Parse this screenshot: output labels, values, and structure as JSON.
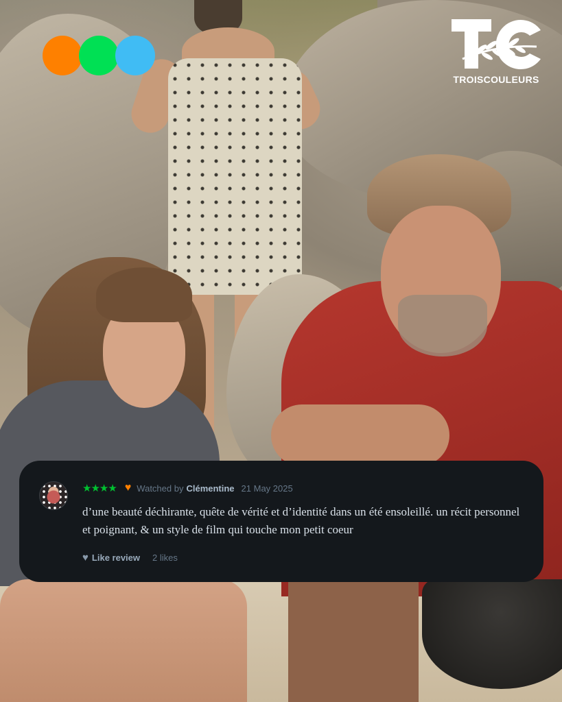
{
  "brand": {
    "dot_colors": [
      "#fe8000",
      "#00e054",
      "#40bcf4"
    ],
    "logo_text": "TROISCOULEURS",
    "logo_mark_letters": "TC"
  },
  "review": {
    "rating_stars": "★★★★",
    "rating": 4,
    "liked": true,
    "watched_by_label": "Watched by",
    "author": "Clémentine",
    "date": "21 May 2025",
    "text": "d’une beauté déchirante, quête de vérité et d’identité dans un été ensoleillé. un récit personnel et poignant, & un style de film qui touche mon petit coeur",
    "like_label": "Like review",
    "likes_count": "2 likes"
  },
  "colors": {
    "card_bg": "#14181c",
    "star_green": "#00c030",
    "heart_orange": "#ff8000",
    "muted_text": "#667788"
  },
  "icons": [
    "star-icon",
    "heart-icon",
    "like-heart-icon",
    "avatar",
    "logo-leaf-icon"
  ]
}
